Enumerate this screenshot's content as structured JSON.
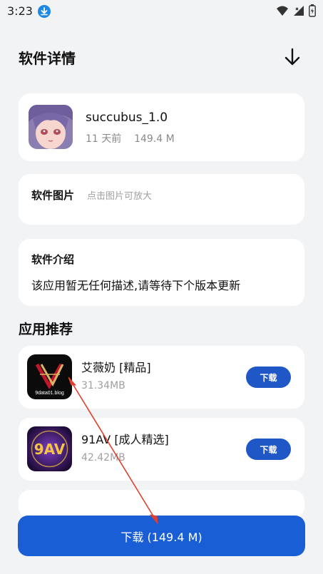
{
  "status": {
    "time": "3:23"
  },
  "page": {
    "title": "软件详情"
  },
  "app": {
    "name": "succubus_1.0",
    "meta": "11 天前    149.4 M"
  },
  "images_section": {
    "label": "软件图片",
    "hint": "点击图片可放大"
  },
  "intro_section": {
    "label": "软件介绍",
    "text": "该应用暂无任何描述,请等待下个版本更新"
  },
  "recommend": {
    "title": "应用推荐",
    "items": [
      {
        "name": "艾薇奶 [精品]",
        "size": "31.34MB",
        "button": "下载",
        "icon_text": "9data01.blog"
      },
      {
        "name": "91AV [成人精选]",
        "size": "42.42MB",
        "button": "下载",
        "icon_text": "9AV"
      }
    ]
  },
  "main_button": {
    "label": "下载 (149.4 M)"
  },
  "colors": {
    "accent": "#1a5ed6",
    "button_small": "#1f58c6",
    "background": "#f2f3f5",
    "annotation": "#e0402f"
  }
}
